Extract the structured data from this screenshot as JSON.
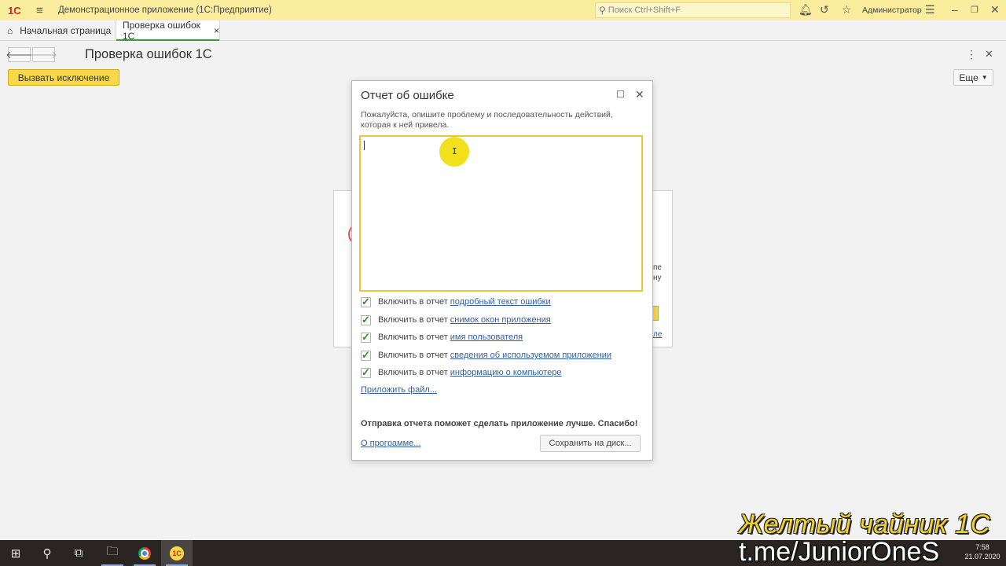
{
  "titlebar": {
    "logo": "1С",
    "app_title": "Демонстрационное приложение  (1С:Предприятие)",
    "search_placeholder": "Поиск Ctrl+Shift+F",
    "user": "Администратор"
  },
  "tabs": {
    "home": "Начальная страница",
    "active": "Проверка ошибок 1С",
    "close_glyph": "×"
  },
  "form": {
    "title": "Проверка ошибок 1С",
    "raise_button": "Вызвать исключение",
    "more_button": "Еще"
  },
  "background_dialog": {
    "fragment1": "пе",
    "fragment2": "ну",
    "fragment3": "ле"
  },
  "dialog": {
    "title": "Отчет об ошибке",
    "description": "Пожалуйста, опишите проблему и последовательность действий, которая к ней привела.",
    "textarea_value": "",
    "checkboxes": [
      {
        "prefix": "Включить в отчет",
        "link": "подробный текст ошибки",
        "checked": true
      },
      {
        "prefix": "Включить в отчет",
        "link": "снимок окон приложения",
        "checked": true
      },
      {
        "prefix": "Включить в отчет",
        "link": "имя пользователя",
        "checked": true
      },
      {
        "prefix": "Включить в отчет",
        "link": "сведения об используемом приложении",
        "checked": true
      },
      {
        "prefix": "Включить в отчет",
        "link": "информацию о компьютере",
        "checked": true
      }
    ],
    "attach_link": "Приложить файл...",
    "thanks": "Отправка отчета поможет сделать приложение лучше. Спасибо!",
    "about_link": "О программе...",
    "save_button": "Сохранить на диск..."
  },
  "taskbar": {
    "time": "7:58",
    "date": "21.07.2020",
    "onec_label": "1С"
  },
  "watermark": {
    "line1": "Желтый чайник 1С",
    "line2": "t.me/JuniorOneS"
  },
  "colors": {
    "titlebar": "#fbed9e",
    "accent_yellow": "#f7d84a",
    "link": "#2f5fa8",
    "tab_underline": "#3aa13a"
  }
}
